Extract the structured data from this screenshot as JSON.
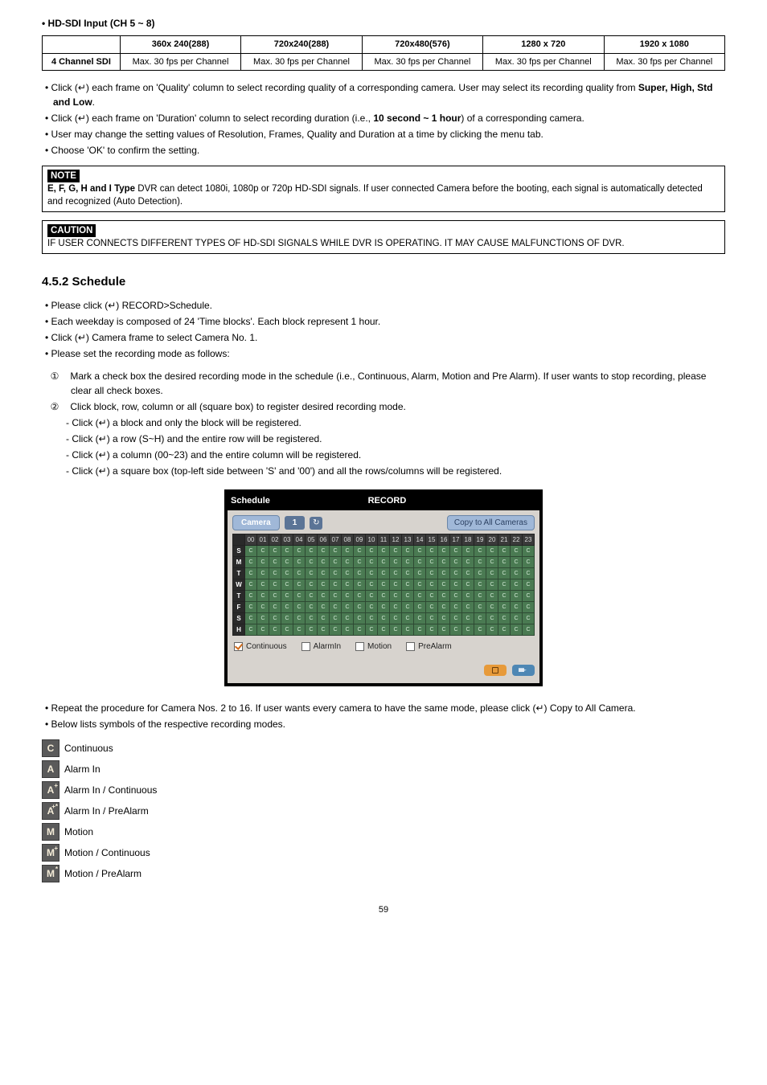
{
  "section_hd_sdi_title": "HD-SDI Input (CH 5 ~ 8)",
  "spec_table": {
    "headers": [
      "360x 240(288)",
      "720x240(288)",
      "720x480(576)",
      "1280 x 720",
      "1920 x 1080"
    ],
    "row_label": "4 Channel SDI",
    "cell": "Max. 30 fps per Channel"
  },
  "bullets_top": {
    "b1a": "Click (↵) each frame on 'Quality' column to select recording quality of a corresponding camera. User may select its recording quality from ",
    "b1b": "Super, High, Std and Low",
    "b1c": ".",
    "b2a": "Click (↵) each frame on 'Duration' column to select recording duration (i.e., ",
    "b2b": "10 second ~ 1 hour",
    "b2c": ") of a corresponding camera.",
    "b3": "User may change the setting values of Resolution, Frames, Quality and Duration at a time by clicking the menu tab.",
    "b4": "Choose 'OK' to confirm the setting."
  },
  "note": {
    "label": "NOTE",
    "bold": "E, F, G, H and I Type",
    "rest": " DVR can detect 1080i, 1080p or 720p HD-SDI signals. If user connected Camera before the booting, each signal is automatically detected and recognized (Auto Detection)."
  },
  "caution": {
    "label": "CAUTION",
    "text": "IF USER CONNECTS DIFFERENT TYPES OF HD-SDI SIGNALS WHILE DVR IS OPERATING. IT MAY CAUSE MALFUNCTIONS OF DVR."
  },
  "heading_schedule": "4.5.2  Schedule",
  "schedule_bullets": {
    "s1": "Please click (↵) RECORD>Schedule.",
    "s2": "Each weekday is composed of 24 'Time blocks'. Each block represent 1 hour.",
    "s3": "Click (↵) Camera frame to select Camera No. 1.",
    "s4": "Please set the recording mode as follows:",
    "n1": "Mark a check box the desired recording mode in the schedule (i.e., Continuous, Alarm, Motion and Pre Alarm). If user wants to stop recording, please clear all check boxes.",
    "n2": "Click block, row, column or all (square box) to register desired recording mode.",
    "d1": "Click (↵) a block and only the block will be registered.",
    "d2": "Click (↵) a row (S~H) and the entire row will be registered.",
    "d3": "Click (↵) a column (00~23) and the entire column will be registered.",
    "d4": "Click (↵) a square box (top-left side between 'S' and '00') and all the rows/columns will be registered."
  },
  "schedule_ui": {
    "title_left": "Schedule",
    "title_right": "RECORD",
    "camera_label": "Camera",
    "camera_num": "1",
    "copy_btn": "Copy to All Cameras",
    "hours": [
      "00",
      "01",
      "02",
      "03",
      "04",
      "05",
      "06",
      "07",
      "08",
      "09",
      "10",
      "11",
      "12",
      "13",
      "14",
      "15",
      "16",
      "17",
      "18",
      "19",
      "20",
      "21",
      "22",
      "23"
    ],
    "days": [
      "S",
      "M",
      "T",
      "W",
      "T",
      "F",
      "S",
      "H"
    ],
    "legend": {
      "continuous": "Continuous",
      "alarmin": "AlarmIn",
      "motion": "Motion",
      "prealarm": "PreAlarm"
    }
  },
  "bullets_bottom": {
    "r1": "Repeat the procedure for Camera Nos. 2 to 16. If user wants every camera to have the same mode, please click (↵) Copy to All Camera.",
    "r2": "Below lists symbols of the respective recording modes."
  },
  "modes": [
    {
      "glyph": "C",
      "sup": "",
      "label": "Continuous"
    },
    {
      "glyph": "A",
      "sup": "",
      "label": "Alarm In"
    },
    {
      "glyph": "A",
      "sup": "+",
      "label": "Alarm In / Continuous"
    },
    {
      "glyph": "A",
      "sup": "+*",
      "label": "Alarm In / PreAlarm"
    },
    {
      "glyph": "M",
      "sup": "",
      "label": "Motion"
    },
    {
      "glyph": "M",
      "sup": "+",
      "label": "Motion / Continuous"
    },
    {
      "glyph": "M",
      "sup": "*",
      "label": "Motion / PreAlarm"
    }
  ],
  "page_number": "59"
}
